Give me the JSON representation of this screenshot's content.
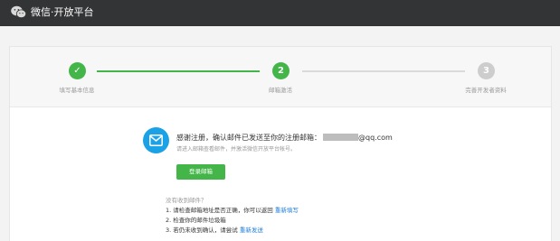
{
  "header": {
    "brand": "微信·开放平台",
    "logo_icon": "wechat-logo-icon"
  },
  "steps": [
    {
      "number": "✓",
      "label": "填写基本信息",
      "state": "done"
    },
    {
      "number": "2",
      "label": "邮箱激活",
      "state": "current"
    },
    {
      "number": "3",
      "label": "完善开发者资料",
      "state": "pending"
    }
  ],
  "notice": {
    "headline": "感谢注册，确认邮件已发送至你的注册邮箱：",
    "email_suffix": "@qq.com",
    "subtext": "请进入邮箱查看邮件，并激活微信开放平台帐号。",
    "login_button": "登录邮箱"
  },
  "faq": {
    "title": "没有收到邮件？",
    "item1_text": "1. 请检查邮箱地址是否正确，你可以返回",
    "item1_link": "重新填写",
    "item2_text": "2. 检查你的邮件垃圾箱",
    "item3_text": "3. 若仍未收到确认，请尝试",
    "item3_link": "重新发送"
  },
  "colors": {
    "accent_green": "#44b549",
    "mail_blue": "#1aa1e6",
    "link_blue": "#1e7dd8",
    "topbar": "#333436"
  }
}
